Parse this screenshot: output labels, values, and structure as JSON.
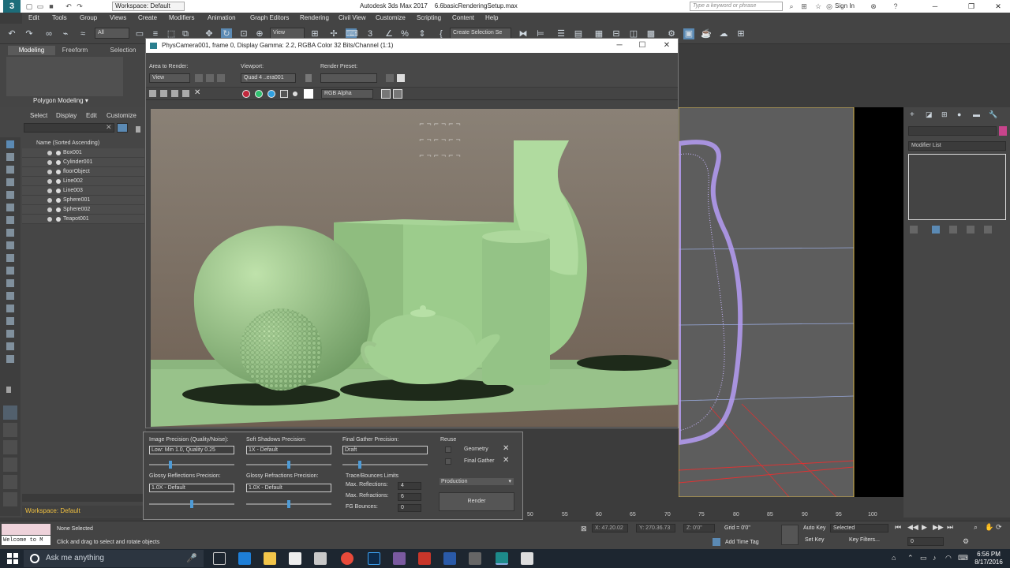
{
  "titlebar": {
    "logo": "3",
    "workspace": "Workspace: Default",
    "app_title": "Autodesk 3ds Max 2017",
    "file_name": "6.6basicRenderingSetup.max",
    "search_placeholder": "Type a keyword or phrase",
    "sign_in": "Sign In"
  },
  "menubar": [
    "Edit",
    "Tools",
    "Group",
    "Views",
    "Create",
    "Modifiers",
    "Animation",
    "Graph Editors",
    "Rendering",
    "Civil View",
    "Customize",
    "Scripting",
    "Content",
    "Help"
  ],
  "toolbar": {
    "selection_filter": "All",
    "reference_coord": "View",
    "create_selection_set": "Create Selection Se"
  },
  "ribbon": {
    "tabs": [
      "Modeling",
      "Freeform",
      "Selection"
    ],
    "polygon_modeling": "Polygon Modeling"
  },
  "scene_explorer": {
    "tabs": [
      "Select",
      "Display",
      "Edit",
      "Customize"
    ],
    "header": "Name (Sorted Ascending)",
    "items": [
      "Box001",
      "Cylinder001",
      "floorObject",
      "Line002",
      "Line003",
      "Sphere001",
      "Sphere002",
      "Teapot001"
    ]
  },
  "frame_window": {
    "title": "PhysCamera001, frame 0, Display Gamma: 2.2, RGBA Color 32 Bits/Channel (1:1)",
    "area_to_render_label": "Area to Render:",
    "area_to_render_value": "View",
    "viewport_label": "Viewport:",
    "viewport_value": "Quad 4 ..era001",
    "render_preset_label": "Render Preset:",
    "channel": "RGB Alpha"
  },
  "render_setup": {
    "image_precision_label": "Image Precision (Quality/Noise):",
    "image_precision_value": "Low: Min 1.0, Quality 0.25",
    "image_precision_slider": 0.25,
    "soft_shadows_label": "Soft Shadows Precision:",
    "soft_shadows_value": "1X - Default",
    "soft_shadows_slider": 0.5,
    "final_gather_label": "Final Gather Precision:",
    "final_gather_value": "Draft",
    "final_gather_slider": 0.2,
    "reuse_label": "Reuse",
    "geometry_label": "Geometry",
    "final_gather_reuse_label": "Final Gather",
    "glossy_reflections_label": "Glossy Reflections Precision:",
    "glossy_reflections_value": "1.0X - Default",
    "glossy_reflections_slider": 0.5,
    "glossy_refractions_label": "Glossy Refractions Precision:",
    "glossy_refractions_value": "1.0X - Default",
    "glossy_refractions_slider": 0.5,
    "trace_label": "Trace/Bounces Limits",
    "max_reflections_label": "Max. Reflections:",
    "max_reflections_value": "4",
    "max_refractions_label": "Max. Refractions:",
    "max_refractions_value": "6",
    "fg_bounces_label": "FG Bounces:",
    "fg_bounces_value": "0",
    "mode": "Production",
    "render_button": "Render"
  },
  "right_panel": {
    "modifier_list": "Modifier List"
  },
  "timeline": {
    "ticks": [
      "50",
      "55",
      "60",
      "65",
      "70",
      "75",
      "80",
      "85",
      "90",
      "95",
      "100"
    ]
  },
  "workspace_bar": "Workspace: Default",
  "status": {
    "welcome": "Welcome to M",
    "none_selected": "None Selected",
    "prompt": "Click and drag to select and rotate objects",
    "x_coord": "X: 47.20.02",
    "y_coord": "Y: 270.36.73",
    "z_coord": "Z: 0'0\"",
    "grid": "Grid = 0'0\"",
    "add_time_tag": "Add Time Tag",
    "auto_key": "Auto Key",
    "selected": "Selected",
    "set_key": "Set Key",
    "key_filters": "Key Filters...",
    "frame": "0"
  },
  "taskbar": {
    "search": "Ask me anything",
    "time": "6:56 PM",
    "date": "8/17/2016"
  },
  "colors": {
    "accent": "#4e9bd6",
    "object_green": "#9ccc8c",
    "wire_purple": "#b59cf5",
    "workspace_yellow": "#f0c040"
  }
}
